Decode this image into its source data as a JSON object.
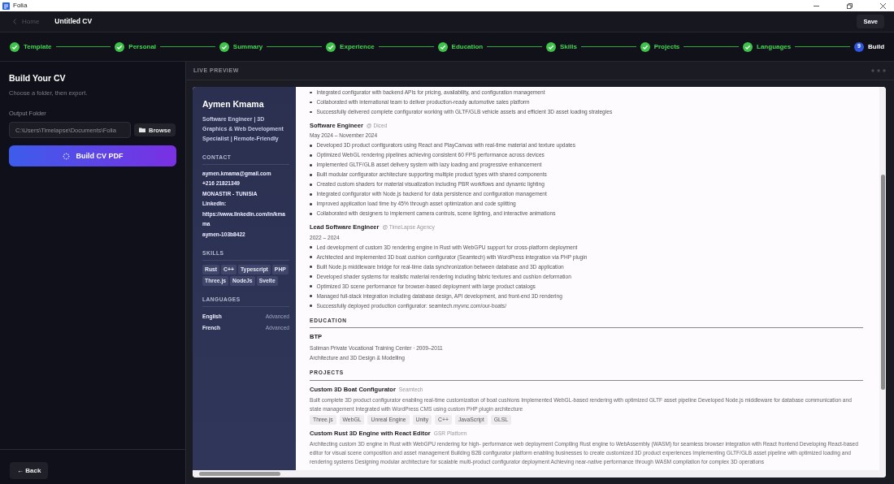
{
  "window": {
    "title": "Folia"
  },
  "header": {
    "back": "Home",
    "title": "Untitled CV",
    "save": "Save"
  },
  "steps": [
    {
      "label": "Template",
      "completed": true,
      "selected": false
    },
    {
      "label": "Personal",
      "completed": true,
      "selected": false
    },
    {
      "label": "Summary",
      "completed": true,
      "selected": false
    },
    {
      "label": "Experience",
      "completed": true,
      "selected": false
    },
    {
      "label": "Education",
      "completed": true,
      "selected": false
    },
    {
      "label": "Skills",
      "completed": true,
      "selected": false
    },
    {
      "label": "Projects",
      "completed": true,
      "selected": false
    },
    {
      "label": "Languages",
      "completed": true,
      "selected": false
    },
    {
      "label": "Build",
      "completed": false,
      "selected": true,
      "number": "9"
    }
  ],
  "builder": {
    "title": "Build Your CV",
    "subtitle": "Choose a folder, then export.",
    "folder_label": "Output Folder",
    "folder_value": "C:\\Users\\Timelapse\\Documents\\Folia",
    "browse": "Browse",
    "build": "Build CV PDF",
    "back": "← Back"
  },
  "preview": {
    "label": "LIVE PREVIEW",
    "cv": {
      "name": "Aymen Kmama",
      "headline": "Software Engineer | 3D Graphics & Web Development Specialist | Remote-Friendly",
      "contact_heading": "CONTACT",
      "contact": [
        "aymen.kmama@gmail.com",
        "+216 21821349",
        "MONASTIR - TUNISIA",
        "LinkedIn:",
        "https://www.linkedin.com/in/kmama",
        "aymen-103b8422"
      ],
      "skills_heading": "SKILLS",
      "skills": [
        "Rust",
        "C++",
        "Typescript",
        "PHP",
        "Three.js",
        "NodeJs",
        "Svelte"
      ],
      "languages_heading": "LANGUAGES",
      "languages": [
        {
          "name": "English",
          "level": "Advanced"
        },
        {
          "name": "French",
          "level": "Advanced"
        }
      ],
      "experience": [
        {
          "bullets": [
            "Integrated configurator with backend APIs for pricing, availability, and configuration management",
            "Collaborated with international team to deliver production-ready automotive sales platform",
            "Successfully delivered complete configurator working with GLTF/GLB vehicle assets and efficient 3D asset loading strategies"
          ]
        },
        {
          "title": "Software Engineer",
          "company": "@ Diced",
          "dates": "May 2024 – November 2024",
          "bullets": [
            "Developed 3D product configurators using React and PlayCanvas with real-time material and texture updates",
            "Optimized WebGL rendering pipelines achieving consistent 60 FPS performance across devices",
            "Implemented GLTF/GLB asset delivery system with lazy loading and progressive enhancement",
            "Built modular configurator architecture supporting multiple product types with shared components",
            "Created custom shaders for material visualization including PBR workflows and dynamic lighting",
            "Integrated configurator with Node.js backend for data persistence and configuration management",
            "Improved application load time by 45% through asset optimization and code splitting",
            "Collaborated with designers to implement camera controls, scene lighting, and interactive animations"
          ]
        },
        {
          "title": "Lead Software Engineer",
          "company": "@ TimeLapse Agency",
          "dates": "2022 – 2024",
          "bullets": [
            "Led development of custom 3D rendering engine in Rust with WebGPU support for cross-platform deployment",
            "Architected and implemented 3D boat cushion configurator (Seamtech) with WordPress integration via PHP plugin",
            "Built Node.js middleware bridge for real-time data synchronization between database and 3D application",
            "Developed shader systems for realistic material rendering including fabric textures and cushion deformation",
            "Optimized 3D scene performance for browser-based deployment with large product catalogs",
            "Managed full-stack integration including database design, API development, and front-end 3D rendering",
            "Successfully deployed production configurator: seamtech.myvnc.com/our-boats/"
          ]
        }
      ],
      "education_heading": "EDUCATION",
      "education": [
        {
          "degree": "BTP",
          "school": "Soliman Private Vocational Training Center · 2009–2011",
          "field": "Architecture and 3D Design & Modelling"
        }
      ],
      "projects_heading": "PROJECTS",
      "projects": [
        {
          "title": "Custom 3D Boat Configurator",
          "org": "Seamtech",
          "description": "Built complete 3D product configurator enabling real-time customization of boat cushions Implemented WebGL-based rendering with optimized GLTF asset pipeline Developed Node.js middleware for database communication and state management Integrated with WordPress CMS using custom PHP plugin architecture",
          "tags": [
            "Three.js",
            "WebGL",
            "Unreal Engine",
            "Unity",
            "C++",
            "JavaScript",
            "GLSL"
          ]
        },
        {
          "title": "Custom Rust 3D Engine with React Editor",
          "org": "GSR Platform",
          "description": "Architecting custom 3D engine in Rust with WebGPU rendering for high- performance web deployment Compiling Rust engine to WebAssembly (WASM) for seamless browser integration with React frontend Developing React-based editor for visual scene composition and asset management Building B2B configurator platform enabling businesses to create customized 3D product experiences Implementing GLTF/GLB asset pipeline with optimized loading and rendering systems Designing modular architecture for scalable multi-product configurator deployment Achieving near-native performance through WASM compilation for complex 3D operations"
        }
      ]
    }
  }
}
